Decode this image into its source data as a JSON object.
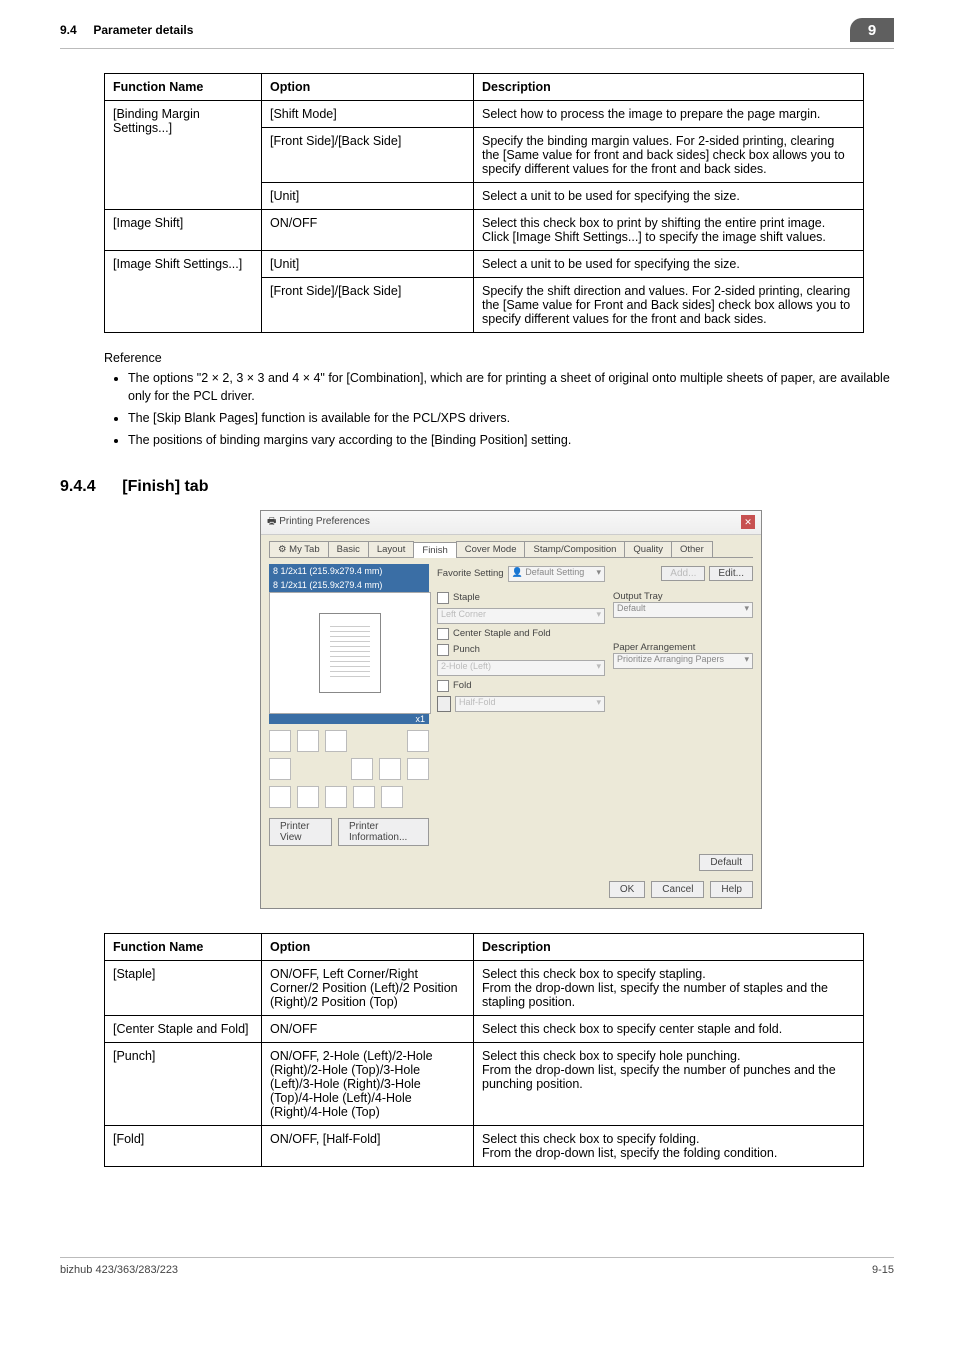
{
  "header": {
    "section_num": "9.4",
    "section_title": "Parameter details",
    "chip": "9"
  },
  "table1": {
    "headers": {
      "fn": "Function Name",
      "op": "Option",
      "desc": "Description"
    },
    "rows": [
      {
        "fn": "[Binding Margin Settings...]",
        "fn_rowspan": 3,
        "cells": [
          {
            "op": "[Shift Mode]",
            "desc": "Select how to process the image to prepare the page margin."
          },
          {
            "op": "[Front Side]/[Back Side]",
            "desc": "Specify the binding margin values. For 2-sided printing, clearing the [Same value for front and back sides] check box allows you to specify different values for the front and back sides."
          },
          {
            "op": "[Unit]",
            "desc": "Select a unit to be used for specifying the size."
          }
        ]
      },
      {
        "fn": "[Image Shift]",
        "fn_rowspan": 1,
        "cells": [
          {
            "op": "ON/OFF",
            "desc": "Select this check box to print by shifting the entire print image. Click [Image Shift Settings...] to specify the image shift values."
          }
        ]
      },
      {
        "fn": "[Image Shift Settings...]",
        "fn_rowspan": 2,
        "cells": [
          {
            "op": "[Unit]",
            "desc": "Select a unit to be used for specifying the size."
          },
          {
            "op": "[Front Side]/[Back Side]",
            "desc": "Specify the shift direction and values. For 2-sided printing, clearing the [Same value for Front and Back sides] check box allows you to specify different values for the front and back sides."
          }
        ]
      }
    ]
  },
  "reference": {
    "title": "Reference",
    "items": [
      "The options \"2 × 2, 3 × 3 and 4 × 4\" for [Combination], which are for printing a sheet of original onto multiple sheets of paper, are available only for the PCL driver.",
      "The [Skip Blank Pages] function is available for the PCL/XPS drivers.",
      "The positions of binding margins vary according to the [Binding Position] setting."
    ]
  },
  "heading": {
    "num": "9.4.4",
    "title": "[Finish] tab"
  },
  "dialog": {
    "title": "Printing Preferences",
    "tabs": [
      "My Tab",
      "Basic",
      "Layout",
      "Finish",
      "Cover Mode",
      "Stamp/Composition",
      "Quality",
      "Other"
    ],
    "active_tab_index": 3,
    "favorite_label": "Favorite Setting",
    "favorite_value": "Default Setting",
    "btn_add": "Add...",
    "btn_edit": "Edit...",
    "paper1": "8 1/2x11 (215.9x279.4 mm)",
    "paper2": "8 1/2x11 (215.9x279.4 mm)",
    "count": "x1",
    "chk_staple": "Staple",
    "combo_staple": "Left Corner",
    "chk_centerstaple": "Center Staple and Fold",
    "chk_punch": "Punch",
    "combo_punch": "2-Hole (Left)",
    "chk_fold": "Fold",
    "combo_fold": "Half-Fold",
    "output_tray_lbl": "Output Tray",
    "output_tray_val": "Default",
    "paper_arr_lbl": "Paper Arrangement",
    "paper_arr_val": "Prioritize Arranging Papers",
    "btn_printerview": "Printer View",
    "btn_printerinfo": "Printer Information...",
    "btn_default": "Default",
    "btn_ok": "OK",
    "btn_cancel": "Cancel",
    "btn_help": "Help"
  },
  "table2": {
    "headers": {
      "fn": "Function Name",
      "op": "Option",
      "desc": "Description"
    },
    "rows": [
      {
        "fn": "[Staple]",
        "op": "ON/OFF, Left Corner/Right Corner/2 Position (Left)/2 Position (Right)/2 Position (Top)",
        "desc": "Select this check box to specify stapling.\nFrom the drop-down list, specify the number of staples and the stapling position."
      },
      {
        "fn": "[Center Staple and Fold]",
        "op": "ON/OFF",
        "desc": "Select this check box to specify center staple and fold."
      },
      {
        "fn": "[Punch]",
        "op": "ON/OFF, 2-Hole (Left)/2-Hole (Right)/2-Hole (Top)/3-Hole (Left)/3-Hole (Right)/3-Hole (Top)/4-Hole (Left)/4-Hole (Right)/4-Hole (Top)",
        "desc": "Select this check box to specify hole punching.\nFrom the drop-down list, specify the number of punches and the punching position."
      },
      {
        "fn": "[Fold]",
        "op": "ON/OFF, [Half-Fold]",
        "desc": "Select this check box to specify folding.\nFrom the drop-down list, specify the folding condition."
      }
    ]
  },
  "footer": {
    "left": "bizhub 423/363/283/223",
    "right": "9-15"
  }
}
